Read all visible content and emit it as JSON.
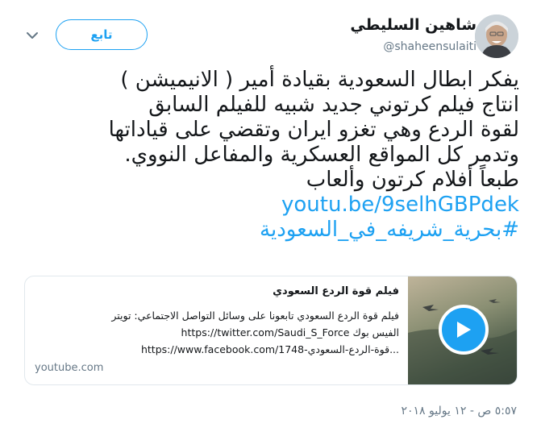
{
  "author": {
    "display_name": "شاهين السليطي",
    "handle": "@shaheensulaiti"
  },
  "actions": {
    "follow_label": "تابع"
  },
  "tweet": {
    "lines": [
      "يفكر ابطال السعودية بقيادة أمير ( الانيميشن )",
      "انتاج فيلم كرتوني جديد شبيه للفيلم السابق",
      "لقوة الردع وهي تغزو ايران وتقضي على قياداتها",
      "وتدمر كل المواقع العسكرية والمفاعل النووي.",
      "طبعاً أفلام كرتون وألعاب"
    ],
    "link": "youtu.be/9selhGBPdek",
    "hashtag": "#بحرية_شريفه_في_السعودية"
  },
  "card": {
    "title": "فيلم قوة الردع السعودي",
    "description_lines": [
      "فيلم قوة الردع السعودي تابعونا على وسائل التواصل الاجتماعي: تويتر",
      "https://twitter.com/Saudi_S_Force الفيس بوك",
      "https://www.facebook.com/قوة-الردع-السعودي-1748..."
    ],
    "domain": "youtube.com",
    "thumbnail_icon": "play-icon"
  },
  "timestamp": "٥:٥٧ ص - ١٢ يوليو ٢٠١٨",
  "colors": {
    "accent": "#1da1f2",
    "text": "#14171a",
    "muted": "#657786",
    "border": "#e1e8ed"
  }
}
